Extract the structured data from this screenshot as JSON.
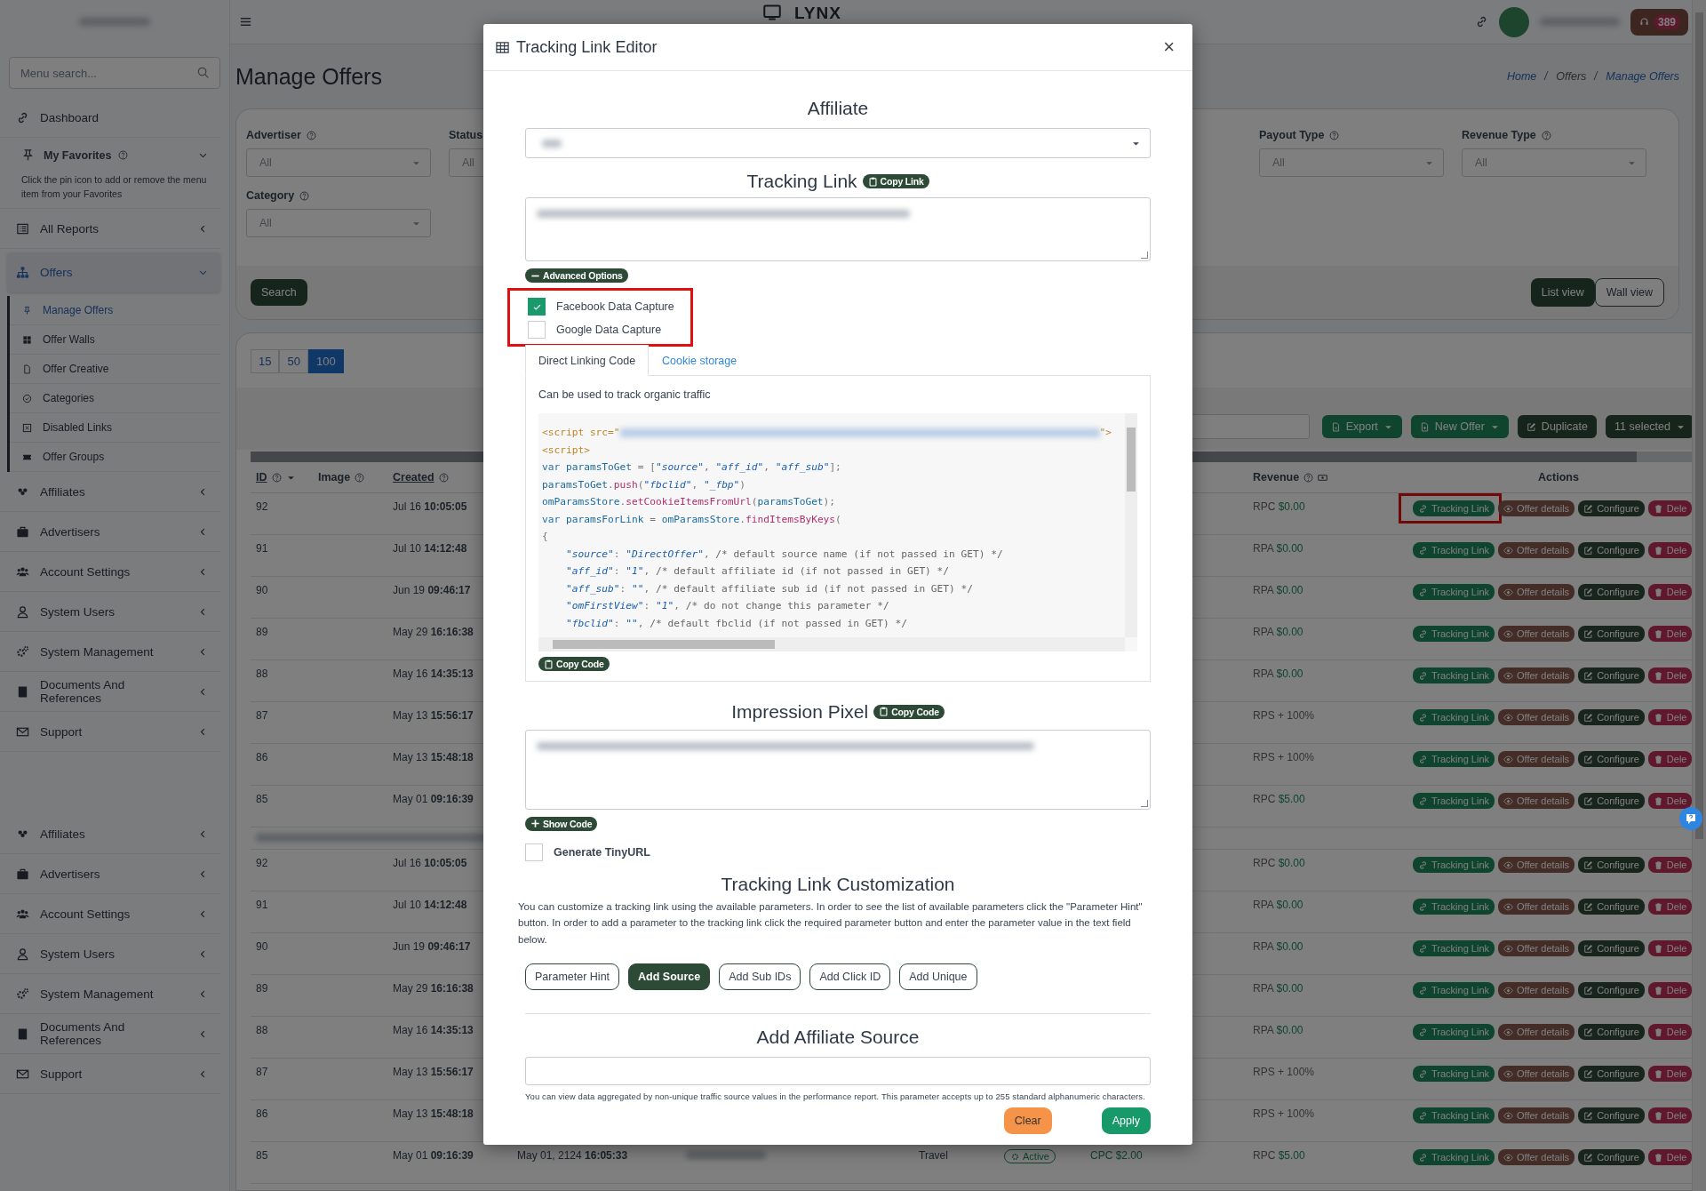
{
  "topbar": {
    "brand": "LYNX",
    "badge": "389"
  },
  "sidebar": {
    "search_placeholder": "Menu search...",
    "dashboard": "Dashboard",
    "favorites": {
      "label": "My Favorites",
      "expanded": true,
      "note": "Click the pin icon to add or remove the menu item from your Favorites"
    },
    "items": [
      {
        "label": "All Reports",
        "expanded": false,
        "selected": false
      },
      {
        "label": "Offers",
        "expanded": true,
        "selected": true,
        "children": [
          {
            "label": "Manage Offers",
            "selected": true
          },
          {
            "label": "Offer Walls",
            "selected": false
          },
          {
            "label": "Offer Creative",
            "selected": false
          },
          {
            "label": "Categories",
            "selected": false
          },
          {
            "label": "Disabled Links",
            "selected": false
          },
          {
            "label": "Offer Groups",
            "selected": false
          }
        ]
      },
      {
        "label": "Affiliates",
        "expanded": false,
        "selected": false
      },
      {
        "label": "Advertisers",
        "expanded": false,
        "selected": false
      },
      {
        "label": "Account Settings",
        "expanded": false,
        "selected": false
      },
      {
        "label": "System Users",
        "expanded": false,
        "selected": false
      },
      {
        "label": "System Management",
        "expanded": false,
        "selected": false
      },
      {
        "label": "Documents And References",
        "expanded": false,
        "selected": false
      },
      {
        "label": "Support",
        "expanded": false,
        "selected": false
      }
    ],
    "items_lower": [
      {
        "label": "Affiliates",
        "expanded": false,
        "selected": false
      },
      {
        "label": "Advertisers",
        "expanded": false,
        "selected": false
      },
      {
        "label": "Account Settings",
        "expanded": false,
        "selected": false
      },
      {
        "label": "System Users",
        "expanded": false,
        "selected": false
      },
      {
        "label": "System Management",
        "expanded": false,
        "selected": false
      },
      {
        "label": "Documents And References",
        "expanded": false,
        "selected": false
      },
      {
        "label": "Support",
        "expanded": false,
        "selected": false
      }
    ]
  },
  "page": {
    "title": "Manage Offers",
    "breadcrumb": [
      "Home",
      "Offers",
      "Manage Offers"
    ]
  },
  "filters": [
    {
      "label": "Advertiser",
      "value": "All"
    },
    {
      "label": "Status",
      "value": "All"
    },
    {
      "label": "Payout Type",
      "value": "All"
    },
    {
      "label": "Revenue Type",
      "value": "All"
    },
    {
      "label": "Category",
      "value": "All"
    }
  ],
  "search_button": "Search",
  "views": [
    {
      "label": "List view",
      "selected": true
    },
    {
      "label": "Wall view",
      "selected": false
    }
  ],
  "page_sizes": [
    {
      "label": "15",
      "selected": false
    },
    {
      "label": "50",
      "selected": false
    },
    {
      "label": "100",
      "selected": true
    }
  ],
  "toolbar": [
    {
      "label": "Export",
      "kind": "export"
    },
    {
      "label": "New Offer",
      "kind": "new"
    },
    {
      "label": "Duplicate",
      "kind": "duplicate"
    },
    {
      "label": "11 selected",
      "kind": "selected"
    }
  ],
  "table": {
    "columns": [
      "ID",
      "Image",
      "Created",
      "Revenue",
      "Actions"
    ],
    "rows": [
      {
        "id": "92",
        "created": "Jul 16 **10:05:05**",
        "revenue_type": "RPC",
        "revenue_amount": "$0.00",
        "highlighted": true,
        "actions": [
          "Tracking Link",
          "Offer details",
          "Configure",
          "Dele"
        ]
      },
      {
        "id": "91",
        "created": "Jul 10 **14:12:48**",
        "revenue_type": "RPA",
        "revenue_amount": "$0.00",
        "highlighted": false,
        "actions": [
          "Tracking Link",
          "Offer details",
          "Configure",
          "Dele"
        ]
      },
      {
        "id": "90",
        "created": "Jun 19 **09:46:17**",
        "revenue_type": "RPA",
        "revenue_amount": "$0.00",
        "highlighted": false,
        "actions": [
          "Tracking Link",
          "Offer details",
          "Configure",
          "Dele"
        ]
      },
      {
        "id": "89",
        "created": "May 29 **16:16:38**",
        "revenue_type": "RPA",
        "revenue_amount": "$0.00",
        "highlighted": false,
        "actions": [
          "Tracking Link",
          "Offer details",
          "Configure",
          "Dele"
        ]
      },
      {
        "id": "88",
        "created": "May 16 **14:35:13**",
        "revenue_type": "RPA",
        "revenue_amount": "$0.00",
        "highlighted": false,
        "actions": [
          "Tracking Link",
          "Offer details",
          "Configure",
          "Dele"
        ]
      },
      {
        "id": "87",
        "created": "May 13 **15:56:17**",
        "revenue_type": "RPS + 100%",
        "highlighted": false,
        "actions": [
          "Tracking Link",
          "Offer details",
          "Configure",
          "Dele"
        ]
      },
      {
        "id": "86",
        "created": "May 13 **15:48:18**",
        "revenue_type": "RPS + 100%",
        "highlighted": false,
        "actions": [
          "Tracking Link",
          "Offer details",
          "Configure",
          "Dele"
        ]
      },
      {
        "id": "85",
        "created": "May 01 **09:16:39**",
        "revenue_type": "RPC",
        "revenue_amount": "$5.00",
        "highlighted": false,
        "actions": [
          "Tracking Link",
          "Offer details",
          "Configure",
          "Dele"
        ]
      }
    ],
    "rows_lower": [
      {
        "id": "92",
        "created": "Jul 16 **10:05:05**",
        "revenue_type": "RPC",
        "revenue_amount": "$0.00",
        "highlighted": false,
        "actions": [
          "Tracking Link",
          "Offer details",
          "Configure",
          "Dele"
        ]
      },
      {
        "id": "91",
        "created": "Jul 10 **14:12:48**",
        "revenue_type": "RPA",
        "revenue_amount": "$0.00",
        "highlighted": false,
        "actions": [
          "Tracking Link",
          "Offer details",
          "Configure",
          "Dele"
        ]
      },
      {
        "id": "90",
        "created": "Jun 19 **09:46:17**",
        "revenue_type": "RPA",
        "revenue_amount": "$0.00",
        "highlighted": false,
        "actions": [
          "Tracking Link",
          "Offer details",
          "Configure",
          "Dele"
        ]
      },
      {
        "id": "89",
        "created": "May 29 **16:16:38**",
        "revenue_type": "RPA",
        "revenue_amount": "$0.00",
        "highlighted": false,
        "actions": [
          "Tracking Link",
          "Offer details",
          "Configure",
          "Dele"
        ]
      },
      {
        "id": "88",
        "created": "May 16 **14:35:13**",
        "revenue_type": "RPA",
        "revenue_amount": "$0.00",
        "highlighted": false,
        "actions": [
          "Tracking Link",
          "Offer details",
          "Configure",
          "Dele"
        ]
      },
      {
        "id": "87",
        "created": "May 13 **15:56:17**",
        "revenue_type": "RPS + 100%",
        "highlighted": false,
        "actions": [
          "Tracking Link",
          "Offer details",
          "Configure",
          "Dele"
        ]
      },
      {
        "id": "86",
        "created": "May 13 **15:48:18**",
        "revenue_type": "RPS + 100%",
        "highlighted": false,
        "actions": [
          "Tracking Link",
          "Offer details",
          "Configure",
          "Dele"
        ]
      },
      {
        "id": "85",
        "created": "May 01 **09:16:39**",
        "published": "May 01, 2124 **16:05:33**",
        "category": "Travel",
        "status": "Active",
        "payout": "CPC $2.00",
        "revenue_type": "RPC",
        "revenue_amount": "$5.00",
        "highlighted": false,
        "actions": [
          "Tracking Link",
          "Offer details",
          "Configure",
          "Dele"
        ]
      }
    ]
  },
  "modal": {
    "title": "Tracking Link Editor",
    "close": "×",
    "affiliate_heading": "Affiliate",
    "tracking_link_heading": "Tracking Link",
    "copy_link": "Copy Link",
    "advanced_options": {
      "label": "Advanced Options",
      "expanded": true
    },
    "capture_highlighted": true,
    "capture_options": [
      {
        "label": "Facebook Data Capture",
        "checked": true
      },
      {
        "label": "Google Data Capture",
        "checked": false
      }
    ],
    "code_tabs": [
      {
        "label": "Direct Linking Code",
        "selected": true
      },
      {
        "label": "Cookie storage",
        "selected": false
      }
    ],
    "code_note": "Can be used to track organic traffic",
    "code_lines": [
      [
        {
          "kind": "tag",
          "text": "<script src=\""
        },
        {
          "kind": "redacted"
        },
        {
          "kind": "tag",
          "text": "\">"
        }
      ],
      [
        {
          "kind": "tag",
          "text": "<script>"
        }
      ],
      [
        {
          "kind": "kw",
          "text": "var"
        },
        {
          "kind": "id",
          "text": " paramsToGet "
        },
        {
          "kind": "op",
          "text": "= ["
        },
        {
          "kind": "str",
          "text": "\"source\""
        },
        {
          "kind": "op",
          "text": ", "
        },
        {
          "kind": "str",
          "text": "\"aff_id\""
        },
        {
          "kind": "op",
          "text": ", "
        },
        {
          "kind": "str",
          "text": "\"aff_sub\""
        },
        {
          "kind": "op",
          "text": "];"
        }
      ],
      [
        {
          "kind": "id",
          "text": "paramsToGet"
        },
        {
          "kind": "op",
          "text": "."
        },
        {
          "kind": "fn",
          "text": "push"
        },
        {
          "kind": "op",
          "text": "("
        },
        {
          "kind": "str",
          "text": "\"fbclid\""
        },
        {
          "kind": "op",
          "text": ", "
        },
        {
          "kind": "str",
          "text": "\"_fbp\""
        },
        {
          "kind": "op",
          "text": ")"
        }
      ],
      [
        {
          "kind": "id",
          "text": "omParamsStore"
        },
        {
          "kind": "op",
          "text": "."
        },
        {
          "kind": "fn",
          "text": "setCookieItemsFromUrl"
        },
        {
          "kind": "op",
          "text": "("
        },
        {
          "kind": "id",
          "text": "paramsToGet"
        },
        {
          "kind": "op",
          "text": ");"
        }
      ],
      [
        {
          "kind": "kw",
          "text": "var"
        },
        {
          "kind": "id",
          "text": " paramsForLink "
        },
        {
          "kind": "op",
          "text": "= "
        },
        {
          "kind": "id",
          "text": "omParamsStore"
        },
        {
          "kind": "op",
          "text": "."
        },
        {
          "kind": "fn",
          "text": "findItemsByKeys"
        },
        {
          "kind": "op",
          "text": "("
        }
      ],
      [
        {
          "kind": "op",
          "text": "{"
        }
      ],
      [
        {
          "kind": "str",
          "text": "    \"source\""
        },
        {
          "kind": "op",
          "text": ": "
        },
        {
          "kind": "str",
          "text": "\"DirectOffer\""
        },
        {
          "kind": "op",
          "text": ", "
        },
        {
          "kind": "cm",
          "text": "/* default source name (if not passed in GET) */"
        }
      ],
      [
        {
          "kind": "str",
          "text": "    \"aff_id\""
        },
        {
          "kind": "op",
          "text": ": "
        },
        {
          "kind": "str",
          "text": "\"1\""
        },
        {
          "kind": "op",
          "text": ", "
        },
        {
          "kind": "cm",
          "text": "/* default affiliate id (if not passed in GET) */"
        }
      ],
      [
        {
          "kind": "str",
          "text": "    \"aff_sub\""
        },
        {
          "kind": "op",
          "text": ": "
        },
        {
          "kind": "str",
          "text": "\"\""
        },
        {
          "kind": "op",
          "text": ", "
        },
        {
          "kind": "cm",
          "text": "/* default affiliate sub id (if not passed in GET) */"
        }
      ],
      [
        {
          "kind": "str",
          "text": "    \"omFirstView\""
        },
        {
          "kind": "op",
          "text": ": "
        },
        {
          "kind": "str",
          "text": "\"1\""
        },
        {
          "kind": "op",
          "text": ", "
        },
        {
          "kind": "cm",
          "text": "/* do not change this parameter */"
        }
      ],
      [
        {
          "kind": "str",
          "text": "    \"fbclid\""
        },
        {
          "kind": "op",
          "text": ": "
        },
        {
          "kind": "str",
          "text": "\"\""
        },
        {
          "kind": "op",
          "text": ", "
        },
        {
          "kind": "cm",
          "text": "/* default fbclid (if not passed in GET) */"
        }
      ]
    ],
    "copy_code": "Copy Code",
    "impression_heading": "Impression Pixel",
    "impression_copy": "Copy Code",
    "show_code": {
      "label": "Show Code",
      "expanded": false
    },
    "tinyurl": {
      "label": "Generate TinyURL",
      "checked": false
    },
    "customization_heading": "Tracking Link Customization",
    "customization_text": "You can customize a tracking link using the available parameters. In order to see the list of available parameters click the \"Parameter Hint\" button. In order to add a parameter to the tracking link click the required parameter button and enter the parameter value in the text field below.",
    "parameter_buttons": [
      {
        "label": "Parameter Hint",
        "selected": false
      },
      {
        "label": "Add Source",
        "selected": true
      },
      {
        "label": "Add Sub IDs",
        "selected": false
      },
      {
        "label": "Add Click ID",
        "selected": false
      },
      {
        "label": "Add Unique",
        "selected": false
      }
    ],
    "source_heading": "Add Affiliate Source",
    "source_hint": "You can view data aggregated by non-unique traffic source values in the performance report. This parameter accepts up to 255 standard alphanumeric characters.",
    "footer_buttons": [
      {
        "label": "Clear",
        "kind": "clear"
      },
      {
        "label": "Apply",
        "kind": "apply"
      }
    ]
  }
}
